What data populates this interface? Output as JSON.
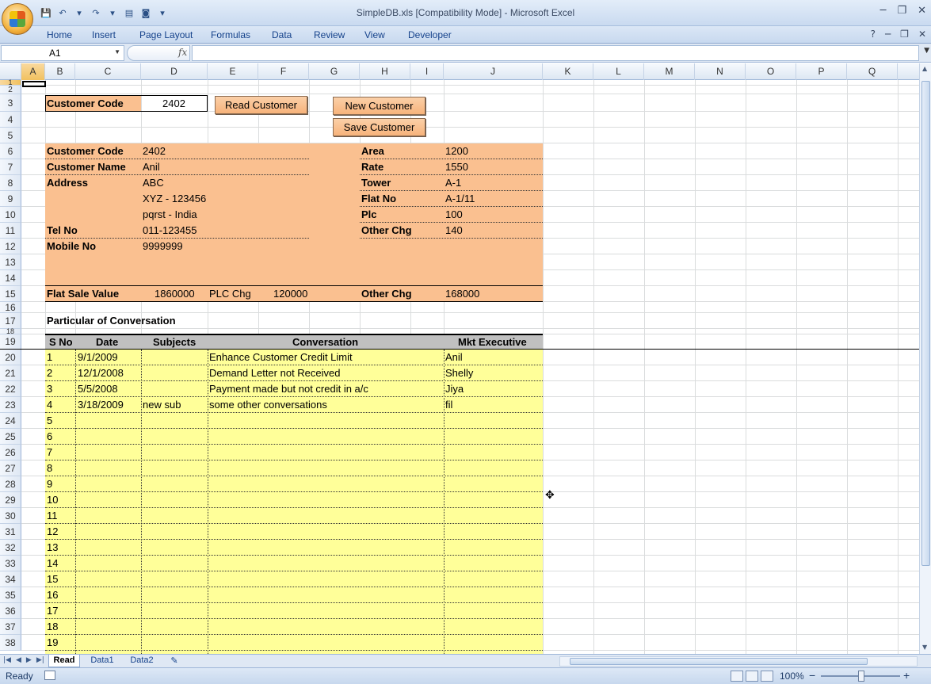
{
  "window": {
    "title": "SimpleDB.xls  [Compatibility Mode] - Microsoft Excel",
    "controls": [
      "─",
      "❐",
      "✕"
    ]
  },
  "ribbon_tabs": [
    "Home",
    "Insert",
    "Page Layout",
    "Formulas",
    "Data",
    "Review",
    "View",
    "Developer"
  ],
  "ribbon_right": [
    "?",
    "─",
    "❐",
    "✕"
  ],
  "formula_bar": {
    "name_box": "A1",
    "fx_label": "fx",
    "formula": ""
  },
  "columns": [
    "A",
    "B",
    "C",
    "D",
    "E",
    "F",
    "G",
    "H",
    "I",
    "J",
    "K",
    "L",
    "M",
    "N",
    "O",
    "P",
    "Q"
  ],
  "rows": [
    "1",
    "2",
    "3",
    "4",
    "5",
    "6",
    "7",
    "8",
    "9",
    "10",
    "11",
    "12",
    "13",
    "14",
    "15",
    "16",
    "17",
    "18",
    "19",
    "20",
    "21",
    "22",
    "23",
    "24",
    "25",
    "26",
    "27",
    "28",
    "29",
    "30",
    "31",
    "32",
    "33",
    "34",
    "35",
    "36",
    "37",
    "38"
  ],
  "lookup": {
    "label": "Customer Code",
    "value": "2402"
  },
  "buttons": {
    "read": "Read Customer",
    "new": "New Customer",
    "save": "Save Customer"
  },
  "customer_left": [
    {
      "label": "Customer Code",
      "value": "2402"
    },
    {
      "label": "Customer Name",
      "value": "Anil"
    },
    {
      "label": "Address",
      "value": "ABC"
    },
    {
      "label": "",
      "value": "XYZ - 123456"
    },
    {
      "label": "",
      "value": "pqrst - India"
    },
    {
      "label": "Tel No",
      "value": "011-123455"
    },
    {
      "label": "Mobile No",
      "value": "9999999"
    }
  ],
  "customer_right": [
    {
      "label": "Area",
      "value": "1200"
    },
    {
      "label": "Rate",
      "value": "1550"
    },
    {
      "label": "Tower",
      "value": "A-1"
    },
    {
      "label": "Flat No",
      "value": "A-1/11"
    },
    {
      "label": "Plc",
      "value": "100"
    },
    {
      "label": "Other Chg",
      "value": "140"
    }
  ],
  "totals": {
    "flat_sale_label": "Flat Sale Value",
    "flat_sale_value": "1860000",
    "plc_label": "PLC Chg",
    "plc_value": "120000",
    "other_label": "Other Chg",
    "other_value": "168000"
  },
  "conversation": {
    "heading": "Particular of Conversation",
    "headers": [
      "S No",
      "Date",
      "Subjects",
      "Conversation",
      "Mkt Executive"
    ],
    "rows": [
      [
        "1",
        "9/1/2009",
        "",
        "Enhance Customer Credit Limit",
        "Anil"
      ],
      [
        "2",
        "12/1/2008",
        "",
        "Demand Letter not Received",
        "Shelly"
      ],
      [
        "3",
        "5/5/2008",
        "",
        "Payment made but not credit in a/c",
        "Jiya"
      ],
      [
        "4",
        "3/18/2009",
        "new sub",
        "some other conversations",
        "fil"
      ],
      [
        "5",
        "",
        "",
        "",
        ""
      ],
      [
        "6",
        "",
        "",
        "",
        ""
      ],
      [
        "7",
        "",
        "",
        "",
        ""
      ],
      [
        "8",
        "",
        "",
        "",
        ""
      ],
      [
        "9",
        "",
        "",
        "",
        ""
      ],
      [
        "10",
        "",
        "",
        "",
        ""
      ],
      [
        "11",
        "",
        "",
        "",
        ""
      ],
      [
        "12",
        "",
        "",
        "",
        ""
      ],
      [
        "13",
        "",
        "",
        "",
        ""
      ],
      [
        "14",
        "",
        "",
        "",
        ""
      ],
      [
        "15",
        "",
        "",
        "",
        ""
      ],
      [
        "16",
        "",
        "",
        "",
        ""
      ],
      [
        "17",
        "",
        "",
        "",
        ""
      ],
      [
        "18",
        "",
        "",
        "",
        ""
      ],
      [
        "19",
        "",
        "",
        "",
        ""
      ]
    ]
  },
  "sheets": [
    "Read",
    "Data1",
    "Data2"
  ],
  "active_sheet": "Read",
  "status": {
    "ready": "Ready",
    "zoom": "100%",
    "zoom_out": "−",
    "zoom_in": "+"
  },
  "colors": {
    "peach": "#fac090",
    "yellow": "#ffff99",
    "header_gray": "#c0c0c0",
    "ribbon_text": "#15428b"
  }
}
